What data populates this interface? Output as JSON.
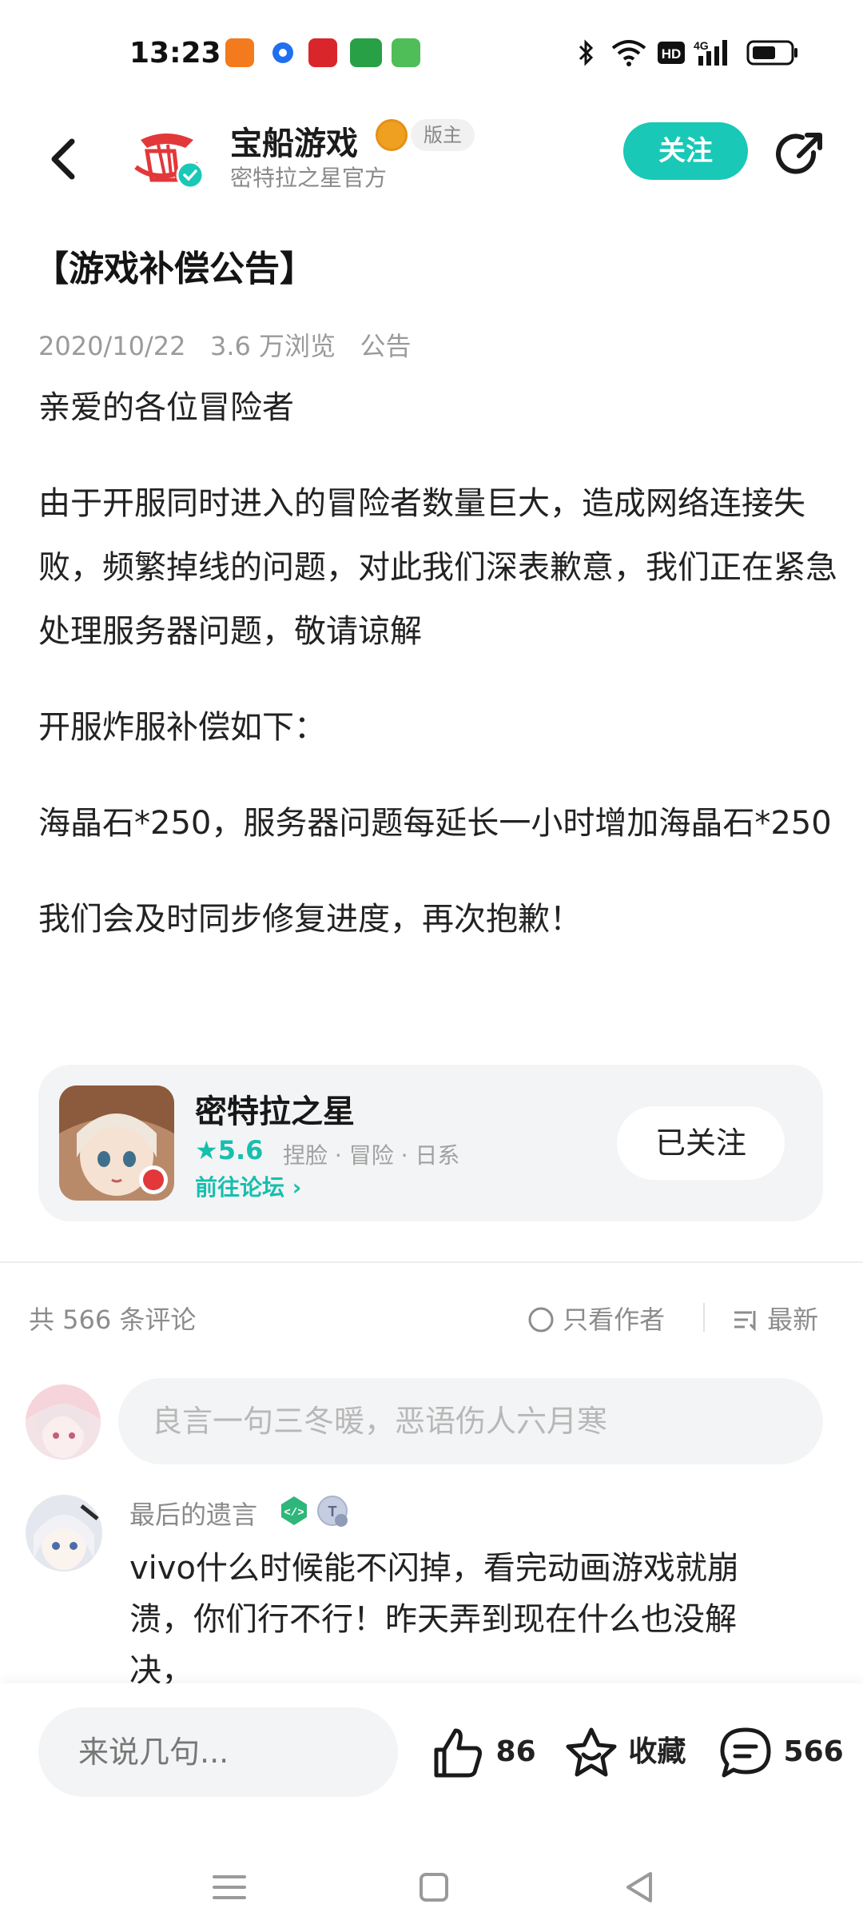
{
  "status_bar": {
    "time": "13:23",
    "icons": [
      "taobao-app-icon",
      "messenger-icon",
      "red-app-icon",
      "oppo-store-icon",
      "wechat-icon",
      "bluetooth-icon",
      "wifi-icon",
      "hd-icon",
      "signal-4g-icon",
      "battery-icon"
    ]
  },
  "header": {
    "title": "宝船游戏",
    "subtitle": "密特拉之星官方",
    "moderator_tag": "版主",
    "follow_label": "关注",
    "accent": "#19C8B6"
  },
  "article": {
    "title": "【游戏补偿公告】",
    "date": "2020/10/22",
    "views": "3.6 万浏览",
    "category": "公告",
    "paragraphs": [
      "亲爱的各位冒险者",
      "由于开服同时进入的冒险者数量巨大，造成网络连接失败，频繁掉线的问题，对此我们深表歉意，我们正在紧急处理服务器问题，敬请谅解",
      "开服炸服补偿如下：",
      "海晶石*250，服务器问题每延长一小时增加海晶石*250",
      "我们会及时同步修复进度，再次抱歉！"
    ]
  },
  "forum_card": {
    "game_name": "密特拉之星",
    "rating": "5.6",
    "tags": "捏脸 · 冒险 · 日系",
    "goto_label": "前往论坛",
    "followed_label": "已关注"
  },
  "comments": {
    "count_label": "共 566 条评论",
    "only_author_label": "只看作者",
    "sort_label": "最新",
    "input_placeholder": "良言一句三冬暖，恶语伤人六月寒",
    "items": [
      {
        "user": "最后的遗言",
        "text": "vivo什么时候能不闪掉，看完动画游戏就崩溃，你们行不行！昨天弄到现在什么也没解决，"
      }
    ]
  },
  "bottom_bar": {
    "input_placeholder": "来说几句...",
    "like_count": "86",
    "favorite_label": "收藏",
    "comment_count": "566"
  },
  "nav_bar": {
    "icons": [
      "menu-icon",
      "home-square-icon",
      "back-triangle-icon"
    ]
  }
}
